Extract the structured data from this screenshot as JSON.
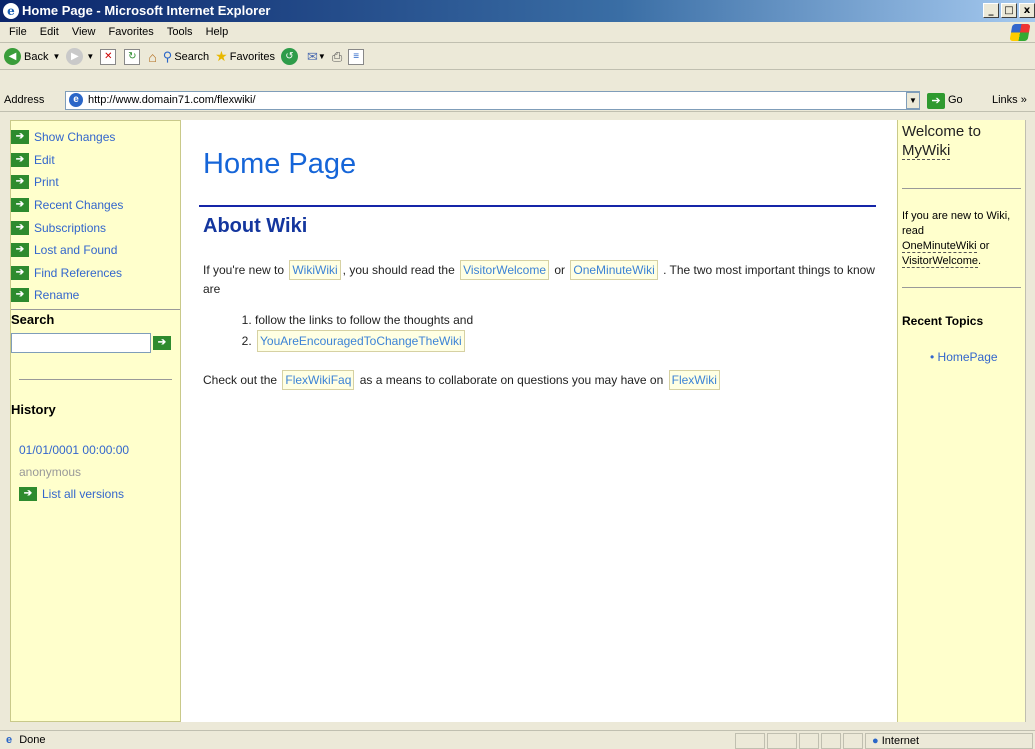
{
  "window": {
    "title": "Home Page - Microsoft Internet Explorer",
    "min": "_",
    "max": "□",
    "close": "x"
  },
  "menu": [
    "File",
    "Edit",
    "View",
    "Favorites",
    "Tools",
    "Help"
  ],
  "toolbar": {
    "back": "Back",
    "search": "Search",
    "favorites": "Favorites"
  },
  "address": {
    "label": "Address",
    "url": "http://www.domain71.com/flexwiki/",
    "go": "Go",
    "links": "Links"
  },
  "left_nav": {
    "items": [
      "Show Changes",
      "Edit",
      "Print",
      "Recent Changes",
      "Subscriptions",
      "Lost and Found",
      "Find References",
      "Rename"
    ],
    "search_heading": "Search",
    "history_heading": "History",
    "history_date": "01/01/0001 00:00:00",
    "history_author": "anonymous",
    "list_versions": "List all versions"
  },
  "main": {
    "title": "Home Page",
    "section": "About Wiki",
    "p1_a": "If you're new to",
    "p1_link1": "WikiWiki",
    "p1_b": ", you should read the",
    "p1_link2": "VisitorWelcome",
    "p1_c": "or",
    "p1_link3": "OneMinuteWiki",
    "p1_d": ". The two most important things to know are",
    "list1": "follow the links to follow the thoughts and",
    "list2": "YouAreEncouragedToChangeTheWiki",
    "p2_a": "Check out the",
    "p2_link1": "FlexWikiFaq",
    "p2_b": "as a means to collaborate on questions you may have on",
    "p2_link2": "FlexWiki"
  },
  "right_col": {
    "welcome_a": "Welcome to",
    "welcome_b": "MyWiki",
    "intro_a": "If you are new to Wiki, read",
    "intro_link1": "OneMinuteWiki",
    "intro_or": "or",
    "intro_link2": "VisitorWelcome",
    "intro_end": ".",
    "recent_heading": "Recent Topics",
    "recent_item": "HomePage"
  },
  "status": {
    "left": "Done",
    "zone": "Internet"
  }
}
